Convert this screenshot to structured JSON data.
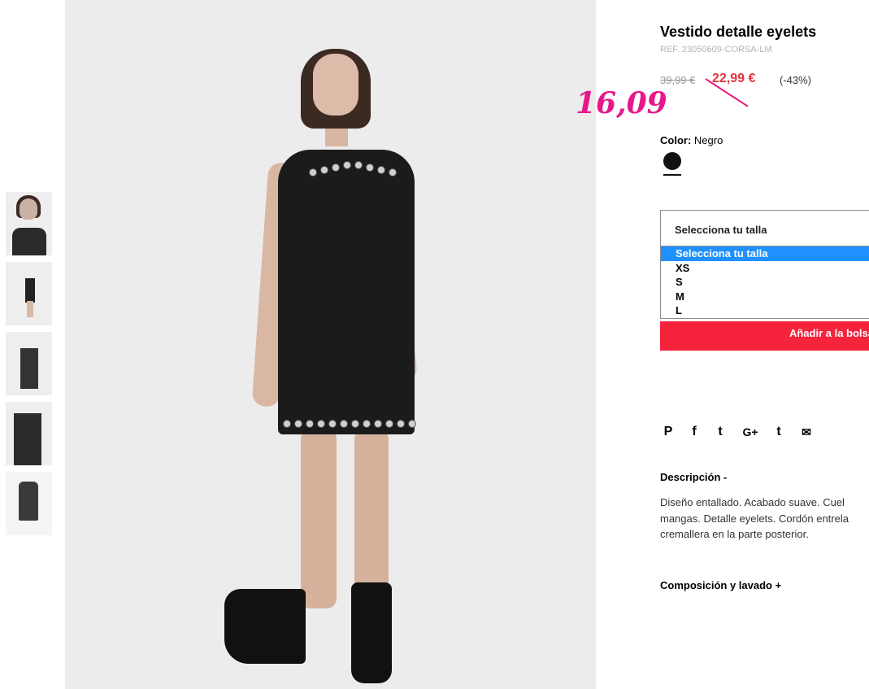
{
  "product": {
    "title": "Vestido detalle eyelets",
    "ref": "REF. 23050609-CORSA-LM",
    "old_price": "39,99 €",
    "new_price": "22,99 €",
    "discount": "(-43%)",
    "handwritten_price": "16,09"
  },
  "color": {
    "label": "Color:",
    "value": "Negro",
    "swatch_color": "#111111"
  },
  "size_select": {
    "selected": "Selecciona tu talla",
    "options": [
      "Selecciona tu talla",
      "XS",
      "S",
      "M",
      "L"
    ]
  },
  "add_button": "Añadir a la bolsa",
  "share_icons": [
    "pinterest-icon",
    "facebook-icon",
    "twitter-icon",
    "google-plus-icon",
    "tumblr-icon",
    "mail-icon"
  ],
  "share_glyphs": [
    "P",
    "f",
    "t",
    "G+",
    "t",
    "✉"
  ],
  "description": {
    "title": "Descripción -",
    "lines": [
      "Diseño entallado. Acabado suave. Cuel",
      "mangas. Detalle eyelets. Cordón entrela",
      "cremallera en la parte posterior."
    ]
  },
  "composition_title": "Composición y lavado +",
  "colors": {
    "price_red": "#e2363c",
    "button_red": "#f5233c",
    "annotation_pink": "#e8178a",
    "select_highlight": "#1e90ff"
  }
}
